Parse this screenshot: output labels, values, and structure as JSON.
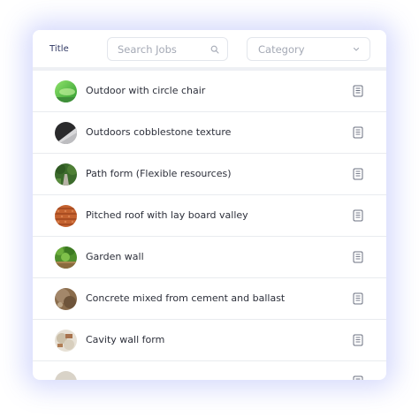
{
  "header": {
    "title": "Title",
    "search_placeholder": "Search Jobs",
    "category_label": "Category"
  },
  "rows": [
    {
      "label": "Outdoor with circle chair",
      "thumb": "grass-green"
    },
    {
      "label": "Outdoors cobblestone texture",
      "thumb": "cobblestone-dark"
    },
    {
      "label": "Path form (Flexible resources)",
      "thumb": "garden-path"
    },
    {
      "label": "Pitched roof with lay board valley",
      "thumb": "terracotta-roof"
    },
    {
      "label": "Garden wall",
      "thumb": "garden-greenery"
    },
    {
      "label": "Concrete mixed from cement and ballast",
      "thumb": "concrete-brown"
    },
    {
      "label": "Cavity wall form",
      "thumb": "cavity-wall"
    },
    {
      "label": "",
      "thumb": "partial"
    }
  ],
  "colors": {
    "accent_glow": "#7a88f5",
    "text_dark": "#2c2f3a",
    "header_text": "#2d3561",
    "placeholder": "#a4a9b5",
    "border": "#e3e6ec"
  },
  "icons": {
    "search": "search-icon",
    "chevron": "chevron-down-icon",
    "row_action": "document-icon"
  }
}
